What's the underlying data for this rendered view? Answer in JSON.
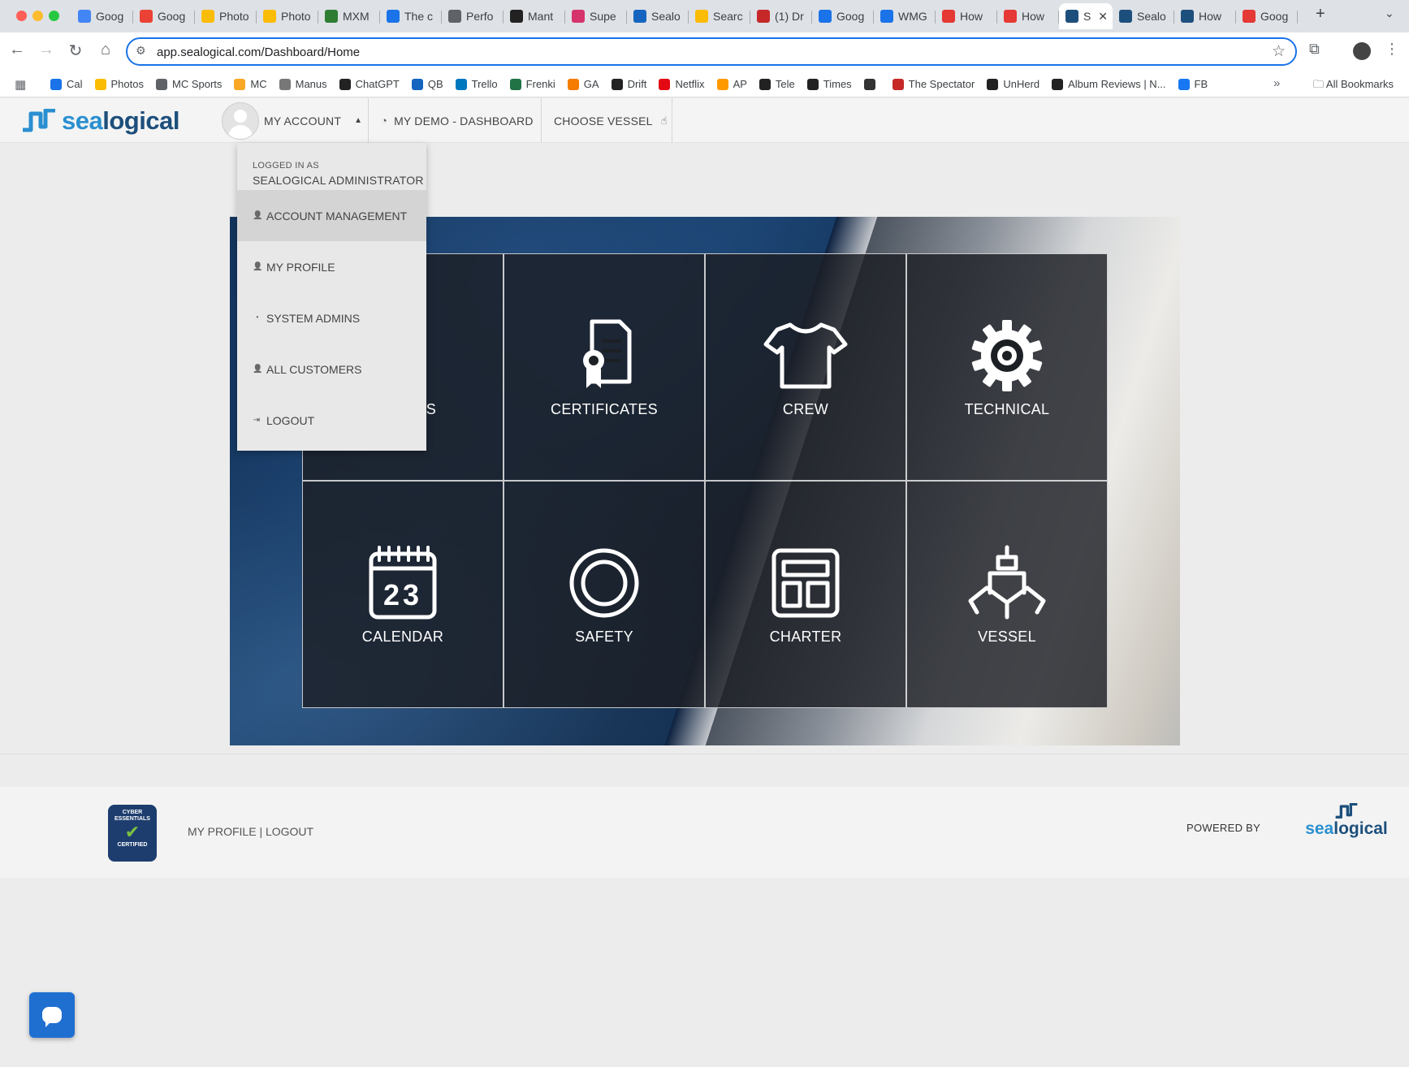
{
  "browser": {
    "tabs": [
      {
        "title": "Goog",
        "color": "#4285f4"
      },
      {
        "title": "Goog",
        "color": "#ea4335"
      },
      {
        "title": "Photo",
        "color": "#fbbc05"
      },
      {
        "title": "Photo",
        "color": "#fbbc05"
      },
      {
        "title": "MXM",
        "color": "#2e7d32"
      },
      {
        "title": "The c",
        "color": "#1a73e8"
      },
      {
        "title": "Perfo",
        "color": "#5f6368"
      },
      {
        "title": "Mant",
        "color": "#222222"
      },
      {
        "title": "Supe",
        "color": "#d6336c"
      },
      {
        "title": "Sealo",
        "color": "#1565c0"
      },
      {
        "title": "Searc",
        "color": "#fbbc05"
      },
      {
        "title": "(1) Dr",
        "color": "#c62828"
      },
      {
        "title": "Goog",
        "color": "#1a73e8"
      },
      {
        "title": "WMG",
        "color": "#1a73e8"
      },
      {
        "title": "How",
        "color": "#e53935"
      },
      {
        "title": "How",
        "color": "#e53935"
      }
    ],
    "active_tab": {
      "title": "S",
      "close": "✕"
    },
    "tabs_after": [
      {
        "title": "Sealo",
        "color": "#1d4f7c"
      },
      {
        "title": "How",
        "color": "#1d4f7c"
      },
      {
        "title": "Goog",
        "color": "#e53935"
      }
    ],
    "new_tab": "+",
    "tab_menu": "⌄",
    "url": "app.sealogical.com/Dashboard/Home",
    "bookmarks": [
      {
        "label": "Cal",
        "color": "#1a73e8"
      },
      {
        "label": "Photos",
        "color": "#fbbc05"
      },
      {
        "label": "MC Sports",
        "color": "#5f6368"
      },
      {
        "label": "MC",
        "color": "#f9a825"
      },
      {
        "label": "Manus",
        "color": "#777777"
      },
      {
        "label": "ChatGPT",
        "color": "#222222"
      },
      {
        "label": "QB",
        "color": "#1565c0"
      },
      {
        "label": "Trello",
        "color": "#0079bf"
      },
      {
        "label": "Frenki",
        "color": "#217346"
      },
      {
        "label": "GA",
        "color": "#f57c00"
      },
      {
        "label": "Drift",
        "color": "#222222"
      },
      {
        "label": "Netflix",
        "color": "#e50914"
      },
      {
        "label": "AP",
        "color": "#ff9900"
      },
      {
        "label": "Tele",
        "color": "#222222"
      },
      {
        "label": "Times",
        "color": "#222222"
      },
      {
        "label": "",
        "color": "#333333"
      },
      {
        "label": "The Spectator",
        "color": "#c62828"
      },
      {
        "label": "UnHerd",
        "color": "#222222"
      },
      {
        "label": "Album Reviews | N...",
        "color": "#222222"
      },
      {
        "label": "FB",
        "color": "#1877f2"
      }
    ],
    "bookmarks_more": "»",
    "all_bookmarks": "All Bookmarks"
  },
  "header": {
    "logo_sea": "sea",
    "logo_rest": "logical",
    "my_account": "MY ACCOUNT",
    "demo_dashboard": "MY DEMO - DASHBOARD",
    "choose_vessel": "CHOOSE VESSEL"
  },
  "dropdown": {
    "logged_in_as": "LOGGED IN AS",
    "user": "SEALOGICAL ADMINISTRATOR",
    "items": [
      {
        "label": "ACCOUNT MANAGEMENT",
        "icon": "user-icon",
        "active": true
      },
      {
        "label": "MY PROFILE",
        "icon": "user-icon",
        "active": false
      },
      {
        "label": "SYSTEM ADMINS",
        "icon": "dashboard-icon",
        "active": false
      },
      {
        "label": "ALL CUSTOMERS",
        "icon": "user-icon",
        "active": false
      },
      {
        "label": "LOGOUT",
        "icon": "logout-icon",
        "active": false
      }
    ]
  },
  "tiles": [
    {
      "label": "S",
      "icon": "hidden-icon"
    },
    {
      "label": "CERTIFICATES",
      "icon": "certificate-icon"
    },
    {
      "label": "CREW",
      "icon": "tshirt-icon"
    },
    {
      "label": "TECHNICAL",
      "icon": "gear-icon"
    },
    {
      "label": "CALENDAR",
      "icon": "calendar-icon",
      "calendar_day": "23"
    },
    {
      "label": "SAFETY",
      "icon": "lifebuoy-icon"
    },
    {
      "label": "CHARTER",
      "icon": "layout-icon"
    },
    {
      "label": "VESSEL",
      "icon": "ship-icon"
    }
  ],
  "footer": {
    "badge_top": "CYBER ESSENTIALS",
    "badge_bottom": "CERTIFIED",
    "my_profile": "MY PROFILE",
    "separator": "|",
    "logout": "LOGOUT",
    "powered_by": "POWERED BY",
    "logo_sea": "sea",
    "logo_rest": "logical"
  },
  "colors": {
    "brand_dark": "#1d4f7c",
    "brand_light": "#2a8fd0",
    "chat_button": "#1f6fd1"
  }
}
